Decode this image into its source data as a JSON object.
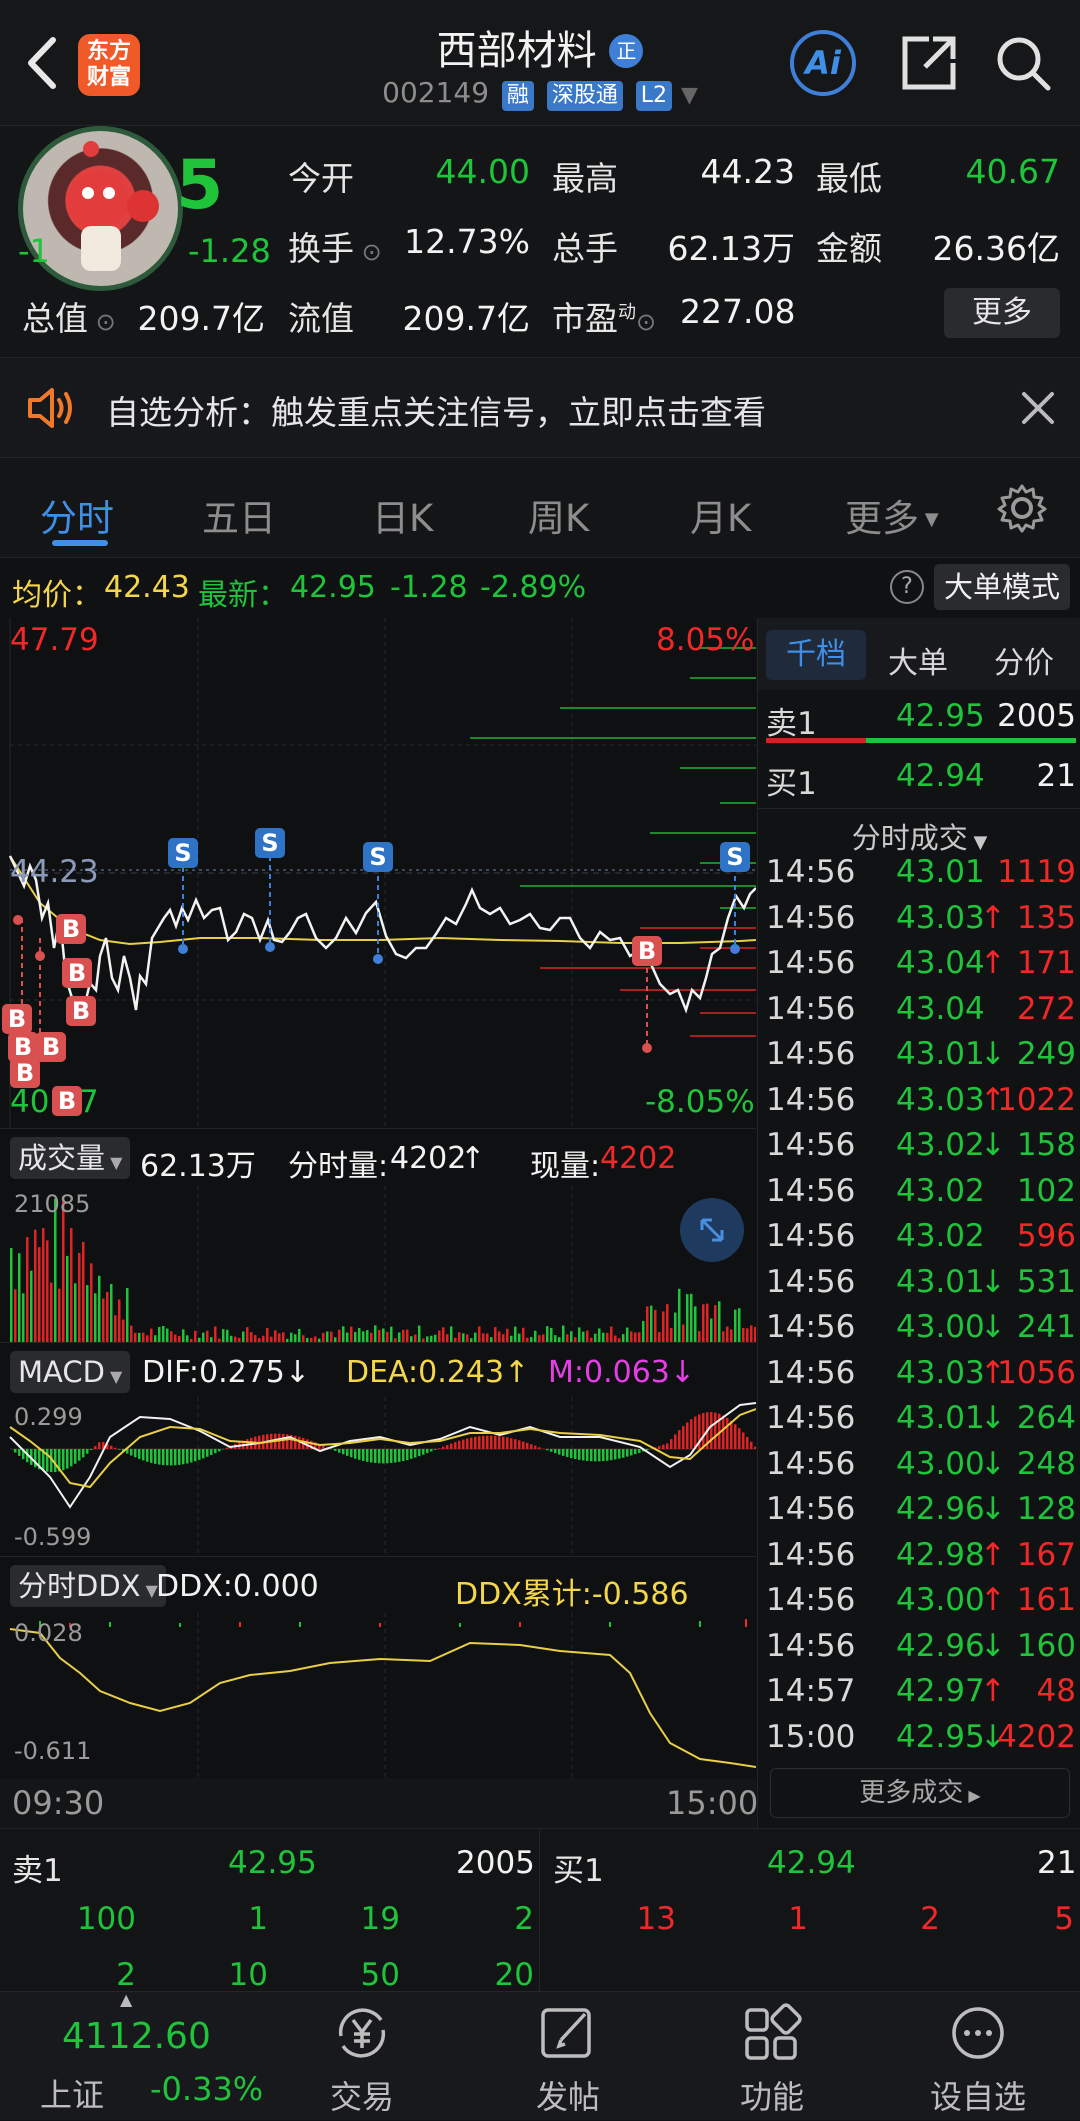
{
  "header": {
    "app_badge_line1": "东方",
    "app_badge_line2": "财富",
    "stock_name": "西部材料",
    "verified_mark": "正",
    "stock_code": "002149",
    "tag_margin": "融",
    "tag_connect": "深股通",
    "tag_level": "L2",
    "ai_label": "Ai"
  },
  "quote": {
    "price_fragment": "5",
    "change_left": "-1",
    "change_right": "-1.28",
    "open_label": "今开",
    "open": "44.00",
    "high_label": "最高",
    "high": "44.23",
    "low_label": "最低",
    "low": "40.67",
    "turnover_label": "换手",
    "turnover": "12.73%",
    "volume_label": "总手",
    "volume": "62.13万",
    "amount_label": "金额",
    "amount": "26.36亿",
    "mcap_label": "总值",
    "mcap": "209.7亿",
    "float_label": "流值",
    "float_mcap": "209.7亿",
    "pe_label": "市盈",
    "pe_sup": "动",
    "pe": "227.08",
    "more_button": "更多"
  },
  "notice": {
    "text": "自选分析：触发重点关注信号，立即点击查看"
  },
  "tabs": [
    "分时",
    "五日",
    "日K",
    "周K",
    "月K",
    "更多"
  ],
  "summary": {
    "avg_label": "均价：",
    "avg": "42.43",
    "last_label": "最新：",
    "last": "42.95",
    "chg": "-1.28",
    "chg_pct": "-2.89%",
    "help": "?",
    "big_mode": "大单模式"
  },
  "price_chart": {
    "max_price": "47.79",
    "max_pct": "8.05%",
    "ref_price": "44.23",
    "min_price": "40.67",
    "min_pct": "-8.05%",
    "buy_marker": "B",
    "sell_marker": "S"
  },
  "volume_panel": {
    "selector": "成交量",
    "total": "62.13万",
    "minute_label": "分时量:",
    "minute_value": "4202",
    "current_label": "现量:",
    "current_value": "4202",
    "axis_max": "21085"
  },
  "macd_panel": {
    "selector": "MACD",
    "dif": "DIF:0.275",
    "dea": "DEA:0.243",
    "m": "M:0.063",
    "axis_top": "0.299",
    "axis_bottom": "-0.599"
  },
  "ddx_panel": {
    "selector": "分时DDX",
    "ddx": "DDX:0.000",
    "ddx_sum": "DDX累计:-0.586",
    "axis_top": "0.028",
    "axis_bottom": "-0.611"
  },
  "time_axis": {
    "start": "09:30",
    "end": "15:00"
  },
  "right_panel": {
    "tabs": [
      "千档",
      "大单",
      "分价"
    ],
    "sell1_label": "卖1",
    "sell1_price": "42.95",
    "sell1_vol": "2005",
    "buy1_label": "买1",
    "buy1_price": "42.94",
    "buy1_vol": "21",
    "trades_title": "分时成交",
    "trades": [
      {
        "time": "14:56",
        "price": "43.01",
        "arrow": "",
        "vol": "1119",
        "pc": "green",
        "vc": "red"
      },
      {
        "time": "14:56",
        "price": "43.03",
        "arrow": "↑",
        "vol": "135",
        "pc": "green",
        "vc": "red"
      },
      {
        "time": "14:56",
        "price": "43.04",
        "arrow": "↑",
        "vol": "171",
        "pc": "green",
        "vc": "red"
      },
      {
        "time": "14:56",
        "price": "43.04",
        "arrow": "",
        "vol": "272",
        "pc": "green",
        "vc": "red"
      },
      {
        "time": "14:56",
        "price": "43.01",
        "arrow": "↓",
        "vol": "249",
        "pc": "green",
        "vc": "green"
      },
      {
        "time": "14:56",
        "price": "43.03",
        "arrow": "↑",
        "vol": "1022",
        "pc": "green",
        "vc": "red"
      },
      {
        "time": "14:56",
        "price": "43.02",
        "arrow": "↓",
        "vol": "158",
        "pc": "green",
        "vc": "green"
      },
      {
        "time": "14:56",
        "price": "43.02",
        "arrow": "",
        "vol": "102",
        "pc": "green",
        "vc": "green"
      },
      {
        "time": "14:56",
        "price": "43.02",
        "arrow": "",
        "vol": "596",
        "pc": "green",
        "vc": "red"
      },
      {
        "time": "14:56",
        "price": "43.01",
        "arrow": "↓",
        "vol": "531",
        "pc": "green",
        "vc": "green"
      },
      {
        "time": "14:56",
        "price": "43.00",
        "arrow": "↓",
        "vol": "241",
        "pc": "green",
        "vc": "green"
      },
      {
        "time": "14:56",
        "price": "43.03",
        "arrow": "↑",
        "vol": "1056",
        "pc": "green",
        "vc": "red"
      },
      {
        "time": "14:56",
        "price": "43.01",
        "arrow": "↓",
        "vol": "264",
        "pc": "green",
        "vc": "green"
      },
      {
        "time": "14:56",
        "price": "43.00",
        "arrow": "↓",
        "vol": "248",
        "pc": "green",
        "vc": "green"
      },
      {
        "time": "14:56",
        "price": "42.96",
        "arrow": "↓",
        "vol": "128",
        "pc": "green",
        "vc": "green"
      },
      {
        "time": "14:56",
        "price": "42.98",
        "arrow": "↑",
        "vol": "167",
        "pc": "green",
        "vc": "red"
      },
      {
        "time": "14:56",
        "price": "43.00",
        "arrow": "↑",
        "vol": "161",
        "pc": "green",
        "vc": "red"
      },
      {
        "time": "14:56",
        "price": "42.96",
        "arrow": "↓",
        "vol": "160",
        "pc": "green",
        "vc": "green"
      },
      {
        "time": "14:57",
        "price": "42.97",
        "arrow": "↑",
        "vol": "48",
        "pc": "green",
        "vc": "red"
      },
      {
        "time": "15:00",
        "price": "42.95",
        "arrow": "↓",
        "vol": "4202",
        "pc": "green",
        "vc": "red"
      }
    ],
    "more_trades": "更多成交"
  },
  "order_book": {
    "sell_label": "卖1",
    "sell_price": "42.95",
    "sell_vol": "2005",
    "buy_label": "买1",
    "buy_price": "42.94",
    "buy_vol": "21",
    "sell_queue_row1": [
      "100",
      "1",
      "19",
      "2"
    ],
    "sell_queue_row2": [
      "2",
      "10",
      "50",
      "20"
    ],
    "buy_queue_row1": [
      "13",
      "1",
      "2",
      "5"
    ]
  },
  "bottom_nav": {
    "index_value": "4112.60",
    "index_name": "上证",
    "index_change": "-0.33%",
    "items": [
      "交易",
      "发帖",
      "功能",
      "设自选"
    ]
  },
  "colors": {
    "up": "#f02828",
    "down": "#1fc43a",
    "accent": "#3f8fe6",
    "avg_line": "#f4d64b"
  }
}
